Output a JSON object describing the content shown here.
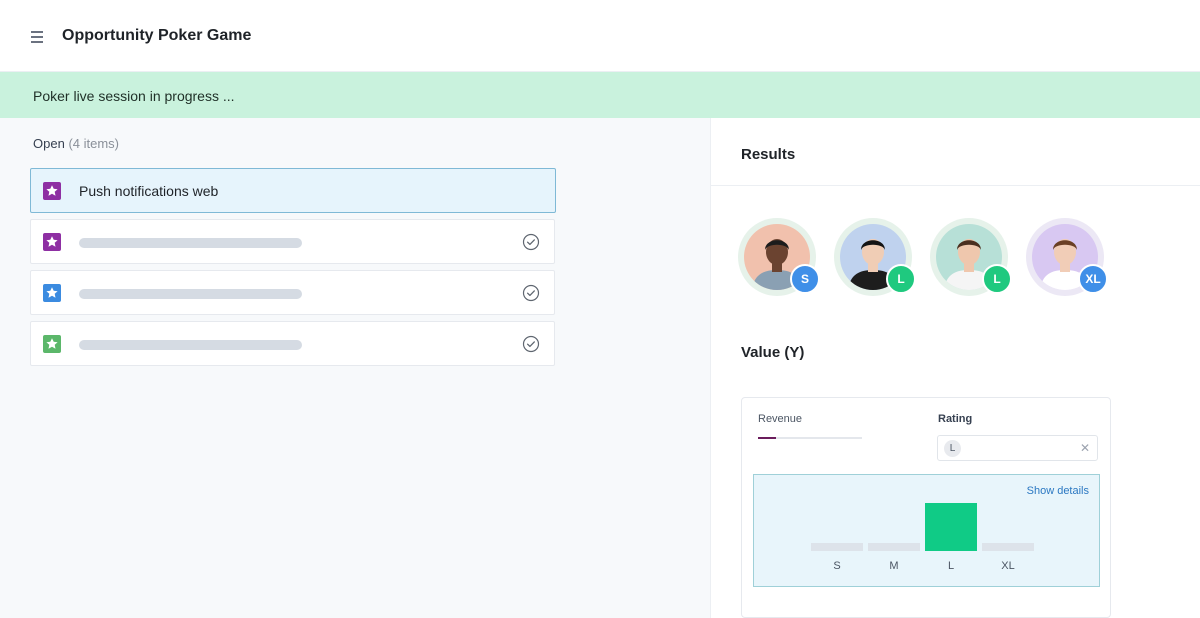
{
  "header": {
    "title": "Opportunity Poker Game",
    "menu_icon": "hamburger-menu-icon"
  },
  "banner": {
    "text": "Poker live session in progress ..."
  },
  "open_list": {
    "label": "Open",
    "count_text": "(4 items)",
    "items": [
      {
        "title": "Push notifications web",
        "icon": "star-icon",
        "color": "#8e2fa3",
        "selected": true
      },
      {
        "title": "",
        "icon": "star-icon",
        "color": "#8e2fa3",
        "selected": false,
        "check_icon": "check-circle-icon"
      },
      {
        "title": "",
        "icon": "star-icon",
        "color": "#3b8be0",
        "selected": false,
        "check_icon": "check-circle-icon"
      },
      {
        "title": "",
        "icon": "star-icon",
        "color": "#5bb76a",
        "selected": false,
        "check_icon": "check-circle-icon"
      }
    ]
  },
  "results": {
    "title": "Results",
    "voters": [
      {
        "vote": "S",
        "badge_color": "#3f8fe8",
        "halo_color": "#e6f2ea",
        "bg_color": "#f1c1ad",
        "skin": "#6b4330",
        "hair": "#1c1c1c",
        "shirt": "#8aa0b3"
      },
      {
        "vote": "L",
        "badge_color": "#1fc97f",
        "halo_color": "#e6f2ea",
        "bg_color": "#bfd2ee",
        "skin": "#f0cdb5",
        "hair": "#141414",
        "shirt": "#1d1d1d"
      },
      {
        "vote": "L",
        "badge_color": "#1fc97f",
        "halo_color": "#e6f2ea",
        "bg_color": "#b7e0d7",
        "skin": "#efc7ad",
        "hair": "#4a2f1f",
        "shirt": "#f5f5f5"
      },
      {
        "vote": "XL",
        "badge_color": "#3f8fe8",
        "halo_color": "#ece8f5",
        "bg_color": "#d8c8f2",
        "skin": "#f1cdb7",
        "hair": "#6a3f25",
        "shirt": "#ffffff"
      }
    ]
  },
  "value": {
    "title": "Value (Y)",
    "revenue_label": "Revenue",
    "revenue_fraction": 0.17,
    "rating_label": "Rating",
    "rating_value": "L",
    "clear_icon": "close-icon",
    "show_details": "Show details"
  },
  "chart_data": {
    "type": "bar",
    "categories": [
      "S",
      "M",
      "L",
      "XL"
    ],
    "values": [
      1,
      0,
      2,
      1
    ],
    "colors": {
      "highlight": "#10cb86",
      "base": "#dde3ea"
    },
    "highlight_category": "L"
  }
}
